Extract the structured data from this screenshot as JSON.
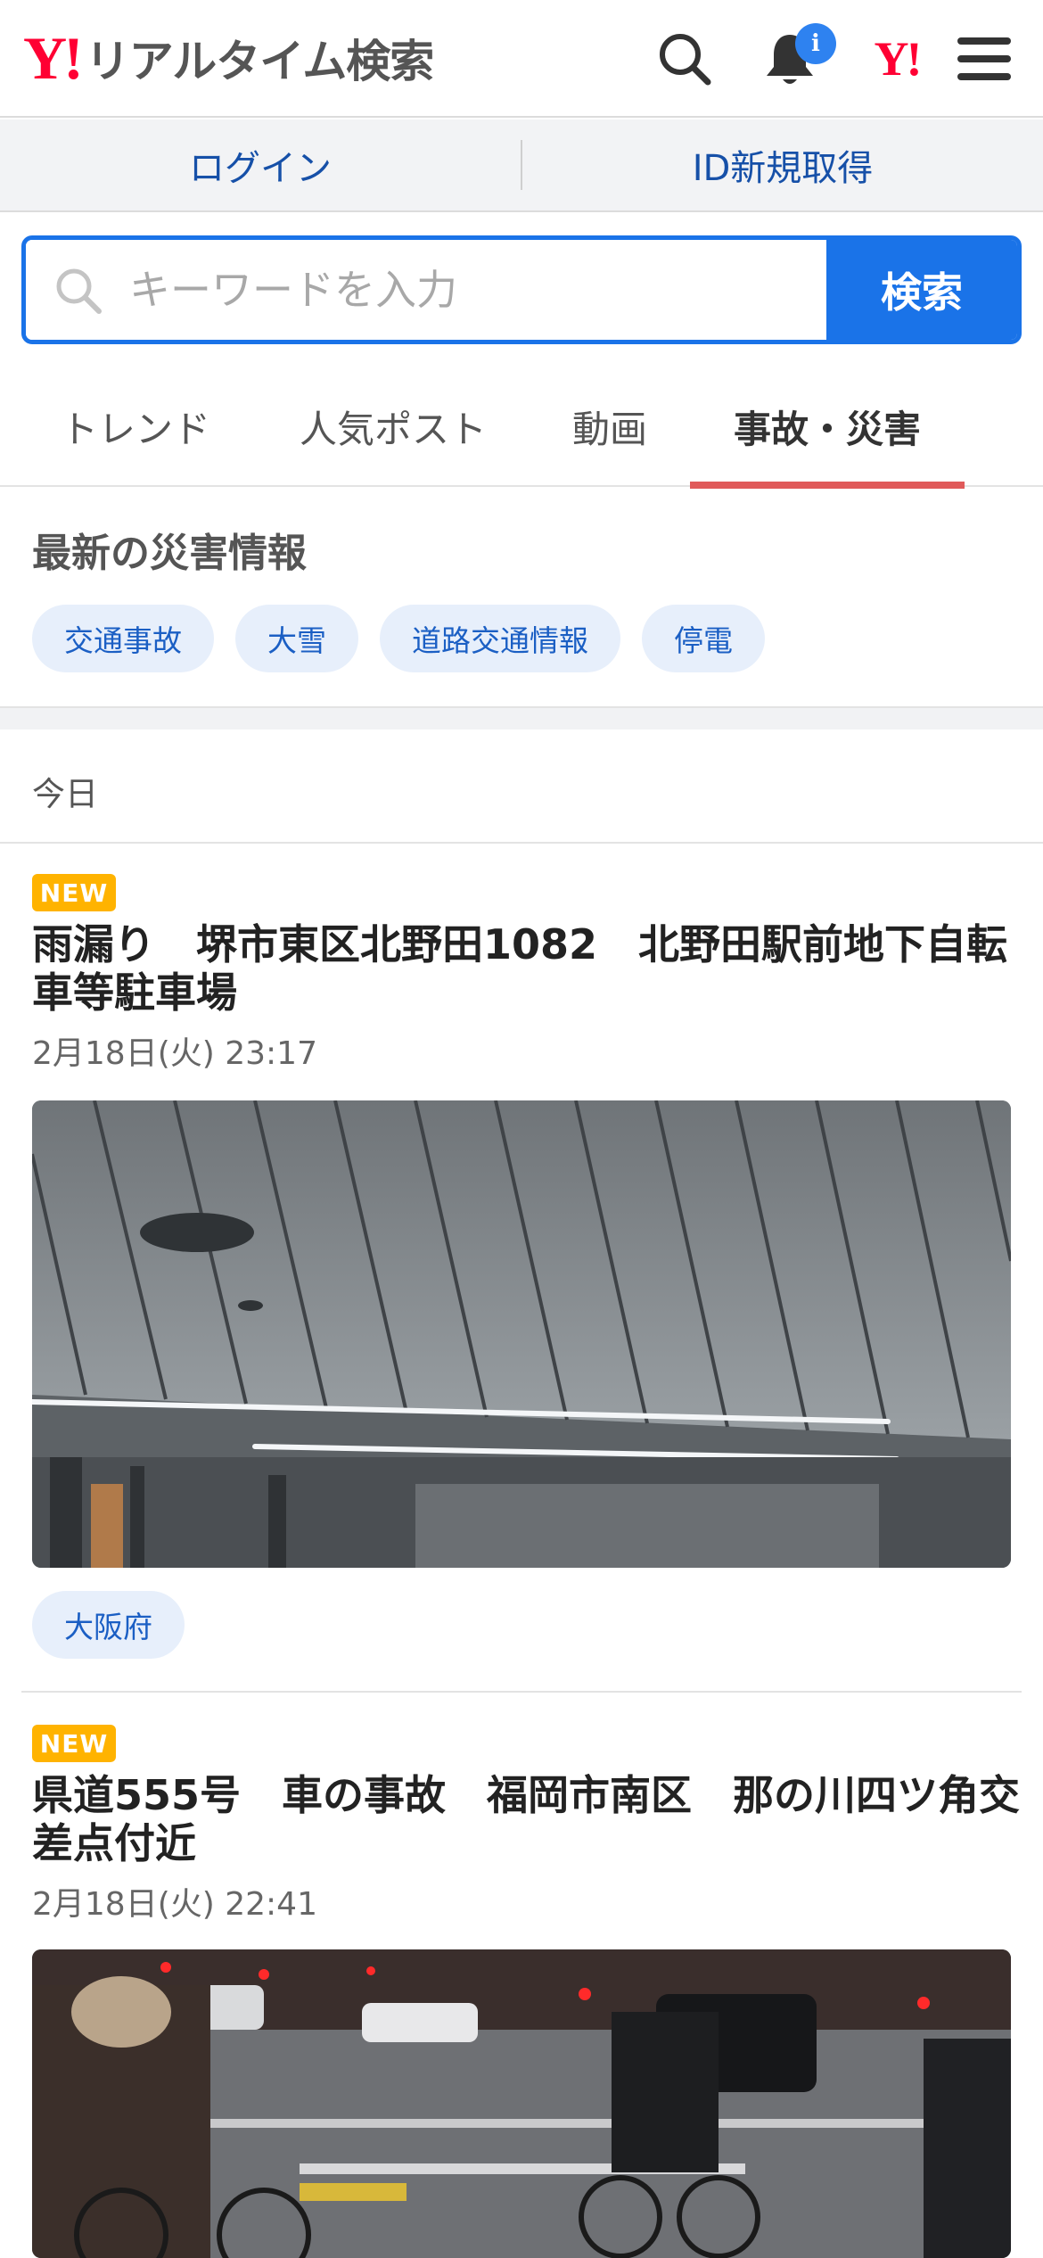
{
  "header": {
    "logo_mark": "Y!",
    "logo_text": "リアルタイム検索",
    "notification_badge": "i",
    "small_logo": "Y!"
  },
  "auth": {
    "login": "ログイン",
    "register": "ID新規取得"
  },
  "search": {
    "placeholder": "キーワードを入力",
    "button": "検索"
  },
  "tabs": [
    {
      "label": "トレンド"
    },
    {
      "label": "人気ポスト"
    },
    {
      "label": "動画"
    },
    {
      "label": "事故・災害",
      "active": true
    }
  ],
  "disaster": {
    "title": "最新の災害情報",
    "chips": [
      "交通事故",
      "大雪",
      "道路交通情報",
      "停電"
    ]
  },
  "section_label": "今日",
  "articles": [
    {
      "badge": "NEW",
      "title": "雨漏り　堺市東区北野田1082　北野田駅前地下自転車等駐車場",
      "date": "2月18日(火) 23:17",
      "prefecture": "大阪府"
    },
    {
      "badge": "NEW",
      "title": "県道555号　車の事故　福岡市南区　那の川四ツ角交差点付近",
      "date": "2月18日(火) 22:41"
    }
  ],
  "colors": {
    "accent": "#1a73e8",
    "brand": "#ff0033",
    "tab_underline": "#e05a5a",
    "new_badge": "#ffb300"
  }
}
